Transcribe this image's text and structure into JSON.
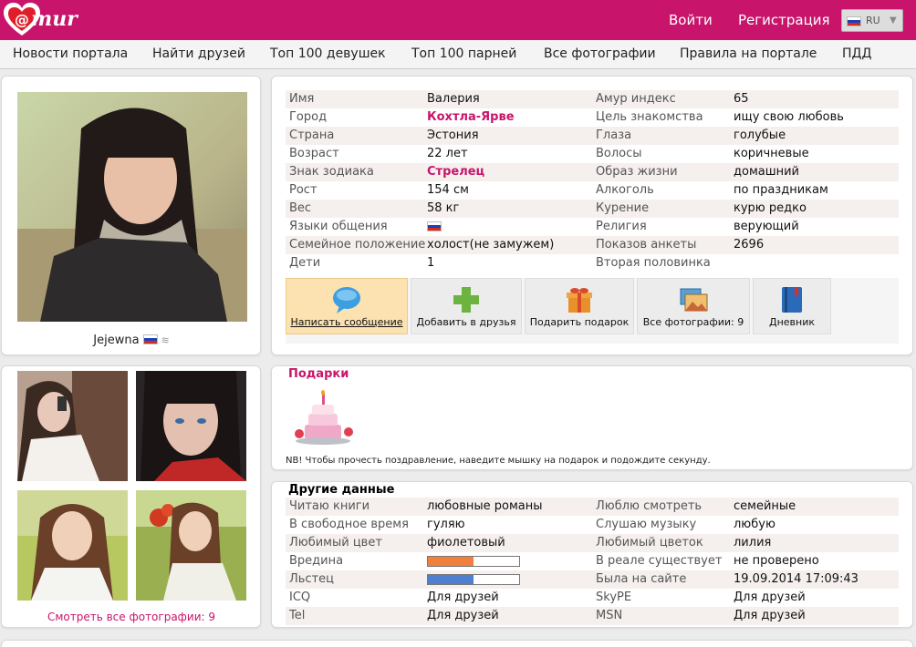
{
  "header": {
    "logo_text": "mur",
    "login": "Войти",
    "register": "Регистрация",
    "lang": "RU"
  },
  "nav": [
    "Новости портала",
    "Найти друзей",
    "Топ 100 девушек",
    "Топ 100 парней",
    "Все фотографии",
    "Правила на портале",
    "ПДД"
  ],
  "user": {
    "name": "Jejewna"
  },
  "profile": {
    "left": [
      {
        "label": "Имя",
        "value": "Валерия"
      },
      {
        "label": "Город",
        "value": "Кохтла-Ярве",
        "link": true
      },
      {
        "label": "Страна",
        "value": "Эстония"
      },
      {
        "label": "Возраст",
        "value": "22 лет"
      },
      {
        "label": "Знак зодиака",
        "value": "Стрелец",
        "link": true
      },
      {
        "label": "Рост",
        "value": "154 см"
      },
      {
        "label": "Вес",
        "value": "58 кг"
      },
      {
        "label": "Языки общения",
        "value": "",
        "flag": true
      },
      {
        "label": "Семейное положение",
        "value": "холост(не замужем)"
      },
      {
        "label": "Дети",
        "value": "1"
      }
    ],
    "right": [
      {
        "label": "Амур индекс",
        "value": "65"
      },
      {
        "label": "Цель знакомства",
        "value": "ищу свою любовь"
      },
      {
        "label": "Глаза",
        "value": "голубые"
      },
      {
        "label": "Волосы",
        "value": "коричневые"
      },
      {
        "label": "Образ жизни",
        "value": "домашний"
      },
      {
        "label": "Алкоголь",
        "value": "по праздникам"
      },
      {
        "label": "Курение",
        "value": "курю редко"
      },
      {
        "label": "Религия",
        "value": "верующий"
      },
      {
        "label": "Показов анкеты",
        "value": "2696"
      },
      {
        "label": "Вторая половинка",
        "value": ""
      }
    ]
  },
  "actions": [
    {
      "label": "Написать сообщение",
      "icon": "speech-bubble-icon"
    },
    {
      "label": "Добавить в друзья",
      "icon": "plus-icon"
    },
    {
      "label": "Подарить подарок",
      "icon": "gift-icon"
    },
    {
      "label": "Все фотографии: 9",
      "icon": "photos-icon"
    },
    {
      "label": "Дневник",
      "icon": "diary-icon"
    }
  ],
  "photos": {
    "all_link": "Смотреть все фотографии: 9"
  },
  "gifts": {
    "title": "Подарки",
    "note": "NB! Чтобы прочесть поздравление, наведите мышку на подарок и подождите секунду."
  },
  "other": {
    "title": "Другие данные",
    "left": [
      {
        "label": "Читаю книги",
        "value": "любовные романы"
      },
      {
        "label": "В свободное время",
        "value": "гуляю"
      },
      {
        "label": "Любимый цвет",
        "value": "фиолетовый"
      },
      {
        "label": "Вредина",
        "bar": 0.5,
        "color": "#f0803c"
      },
      {
        "label": "Льстец",
        "bar": 0.5,
        "color": "#4f7fcf"
      },
      {
        "label": "ICQ",
        "value": "Для друзей"
      },
      {
        "label": "Tel",
        "value": "Для друзей"
      }
    ],
    "right": [
      {
        "label": "Люблю смотреть",
        "value": "семейные"
      },
      {
        "label": "Слушаю музыку",
        "value": "любую"
      },
      {
        "label": "Любимый цветок",
        "value": "лилия"
      },
      {
        "label": "В реале существует",
        "value": "не проверено"
      },
      {
        "label": "Была на сайте",
        "value": "19.09.2014 17:09:43"
      },
      {
        "label": "SkyPE",
        "value": "Для друзей"
      },
      {
        "label": "MSN",
        "value": "Для друзей"
      }
    ]
  },
  "colors": {
    "brand": "#c8156b"
  }
}
